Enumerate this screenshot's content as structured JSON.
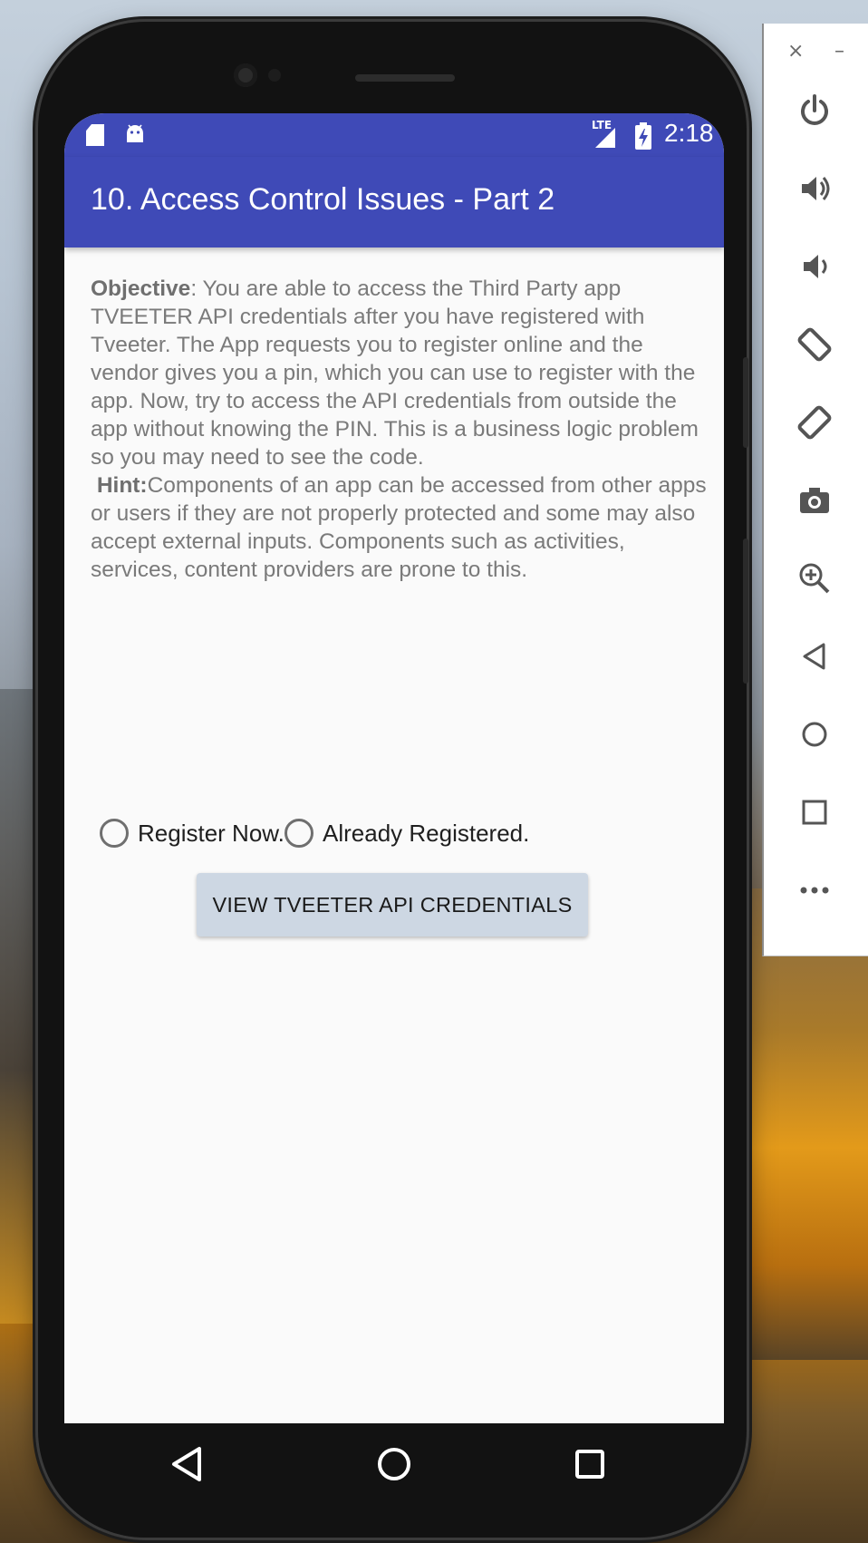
{
  "status_bar": {
    "network": "LTE",
    "time": "2:18"
  },
  "app_bar": {
    "title": "10. Access Control Issues - Part 2"
  },
  "content": {
    "objective_label": "Objective",
    "objective_text": ": You are able to access the Third Party app TVEETER API credentials after you have registered with Tveeter. The App requests you to register online and the vendor gives you a pin, which you can use to register with the app. Now, try to access the API credentials from outside the app without knowing the PIN. This is a business logic problem so you may need to see the code.",
    "hint_label": "Hint:",
    "hint_text": "Components of an app can be accessed from other apps or users if they are not properly protected and some may also accept external inputs. Components such as activities, services, content providers are prone to this."
  },
  "radio_options": [
    {
      "label": "Register Now.",
      "selected": false
    },
    {
      "label": "Already Registered.",
      "selected": false
    }
  ],
  "primary_button": {
    "label": "VIEW TVEETER API CREDENTIALS"
  },
  "navigation": {
    "back_icon": "back-triangle-icon",
    "home_icon": "home-circle-icon",
    "recents_icon": "recents-square-icon"
  },
  "emulator_panel": {
    "close_label": "×",
    "minimize_label": "–",
    "buttons": [
      "power-icon",
      "volume-up-icon",
      "volume-down-icon",
      "rotate-left-icon",
      "rotate-right-icon",
      "camera-icon",
      "zoom-icon",
      "back-icon",
      "home-icon",
      "overview-icon",
      "more-icon"
    ]
  },
  "colors": {
    "app_bar": "#3f4ab7",
    "screen_background": "#fafafa",
    "button_background": "#cdd7e3",
    "body_text": "#7a7a7a"
  }
}
